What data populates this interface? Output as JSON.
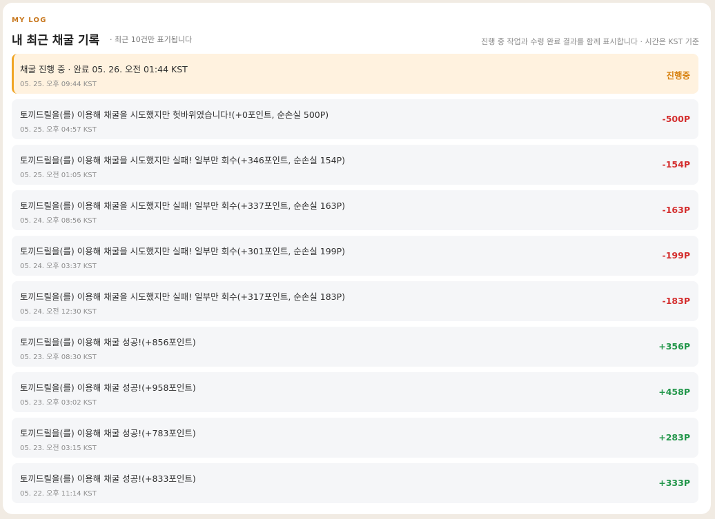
{
  "header": {
    "eyebrow": "MY LOG",
    "title": "내 최근 채굴 기록",
    "subtitle": "· 최근 10건만 표기됩니다",
    "note": "진행 중 작업과 수령 완료 결과를 함께 표시합니다 · 시간은 KST 기준"
  },
  "logs": [
    {
      "title": "채굴 진행 중 · 완료 05. 26. 오전 01:44 KST",
      "time": "05. 25. 오후 09:44 KST",
      "value": "진행중",
      "status": "progress"
    },
    {
      "title": "토끼드릴을(를) 이용해 채굴을 시도했지만 헛바위였습니다!(+0포인트, 순손실 500P)",
      "time": "05. 25. 오후 04:57 KST",
      "value": "-500P",
      "status": "loss"
    },
    {
      "title": "토끼드릴을(를) 이용해 채굴을 시도했지만 실패! 일부만 회수(+346포인트, 순손실 154P)",
      "time": "05. 25. 오전 01:05 KST",
      "value": "-154P",
      "status": "loss"
    },
    {
      "title": "토끼드릴을(를) 이용해 채굴을 시도했지만 실패! 일부만 회수(+337포인트, 순손실 163P)",
      "time": "05. 24. 오후 08:56 KST",
      "value": "-163P",
      "status": "loss"
    },
    {
      "title": "토끼드릴을(를) 이용해 채굴을 시도했지만 실패! 일부만 회수(+301포인트, 순손실 199P)",
      "time": "05. 24. 오후 03:37 KST",
      "value": "-199P",
      "status": "loss"
    },
    {
      "title": "토끼드릴을(를) 이용해 채굴을 시도했지만 실패! 일부만 회수(+317포인트, 순손실 183P)",
      "time": "05. 24. 오전 12:30 KST",
      "value": "-183P",
      "status": "loss"
    },
    {
      "title": "토끼드릴을(를) 이용해 채굴 성공!(+856포인트)",
      "time": "05. 23. 오후 08:30 KST",
      "value": "+356P",
      "status": "gain"
    },
    {
      "title": "토끼드릴을(를) 이용해 채굴 성공!(+958포인트)",
      "time": "05. 23. 오후 03:02 KST",
      "value": "+458P",
      "status": "gain"
    },
    {
      "title": "토끼드릴을(를) 이용해 채굴 성공!(+783포인트)",
      "time": "05. 23. 오전 03:15 KST",
      "value": "+283P",
      "status": "gain"
    },
    {
      "title": "토끼드릴을(를) 이용해 채굴 성공!(+833포인트)",
      "time": "05. 22. 오후 11:14 KST",
      "value": "+333P",
      "status": "gain"
    }
  ],
  "colors": {
    "accent": "#c8781f",
    "progress": "#d88312",
    "loss": "#d42f2f",
    "gain": "#22964a",
    "active_background": "#fff2df",
    "row_background": "#f5f6f8"
  }
}
